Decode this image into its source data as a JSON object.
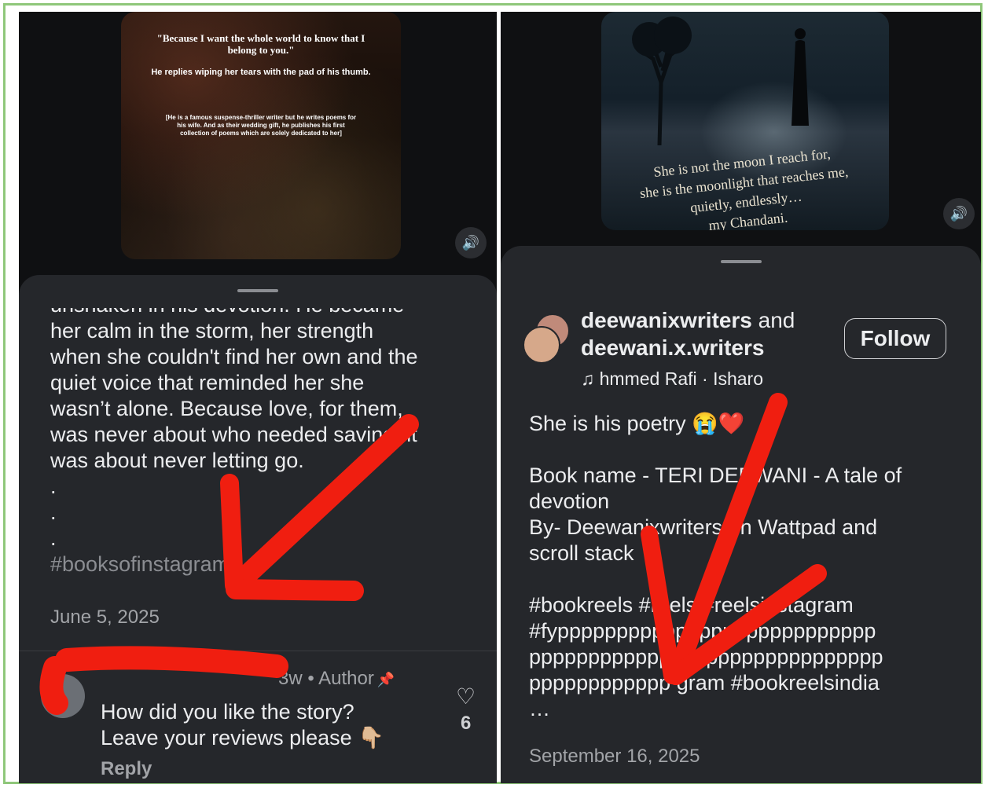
{
  "left": {
    "poster": {
      "quote": "\"Because I want the whole world to know that I belong to you.\"",
      "line": "He replies wiping her tears with the pad of his thumb.",
      "note": "[He is a famous suspense-thriller writer but he writes poems for his wife. And as their wedding gift, he publishes his first collection of poems which are solely dedicated to her]"
    },
    "caption_top_partial": "unshaken in his devotion. He became",
    "caption": "her calm in the storm, her strength\nwhen she couldn't find her own and the\nquiet voice that reminded her she\nwasn’t alone. Because love, for them,\nwas never about who needed saving: it\nwas about never letting go.\n.\n.\n.",
    "hashtag": "#booksofinstagram",
    "date": "June 5, 2025",
    "comment": {
      "meta": "3w • Author",
      "text_line1": "How did you like the story?",
      "text_line2": "Leave your reviews please 👇🏼",
      "reply_label": "Reply",
      "likes": "6"
    }
  },
  "right": {
    "poster_text": "She is not the moon I reach for,\nshe is the moonlight that reaches me,\nquietly, endlessly…\nmy Chandani.",
    "user_primary": "deewanixwriters",
    "user_and": "and",
    "user_secondary": "deewani.x.writers",
    "music": "♫ hmmed Rafi · Isharo",
    "follow_label": "Follow",
    "caption": "She is his poetry 😭❤️\n\nBook name - TERI DEEWANI - A tale of\ndevotion\nBy- Deewanixwriters on Wattpad and\nscroll stack\n\n#bookreels #reels #reelsinstagram\n#fyppppppppppppppppppppppppppp\npppppppppppppppppppppppppppppp\npppppppppppp gram #bookreelsindia\n…",
    "date": "September 16, 2025"
  },
  "icons": {
    "sound": "speaker-icon",
    "like": "heart-icon",
    "pin": "pin-icon",
    "music": "music-note-icon"
  },
  "colors": {
    "sheet": "#25272b",
    "background": "#141517",
    "annotation": "#f01e10",
    "frame": "#8fc77a"
  }
}
